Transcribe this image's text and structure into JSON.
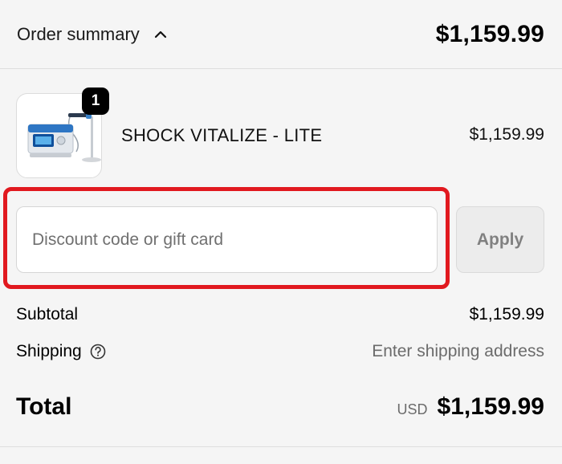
{
  "header": {
    "title": "Order summary",
    "toggle_icon": "chevron-up-icon",
    "total": "$1,159.99"
  },
  "product": {
    "quantity": "1",
    "name": "SHOCK VITALIZE - LITE",
    "price": "$1,159.99",
    "image_icon": "shockwave-device-thumbnail"
  },
  "discount": {
    "placeholder": "Discount code or gift card",
    "value": "",
    "apply_label": "Apply"
  },
  "summary": {
    "subtotal_label": "Subtotal",
    "subtotal_value": "$1,159.99",
    "shipping_label": "Shipping",
    "shipping_help_icon": "help-circle-icon",
    "shipping_value": "Enter shipping address",
    "total_label": "Total",
    "currency": "USD",
    "total_value": "$1,159.99"
  },
  "colors": {
    "background": "#f5f5f5",
    "highlight": "#e1191f",
    "badge": "#000000"
  }
}
